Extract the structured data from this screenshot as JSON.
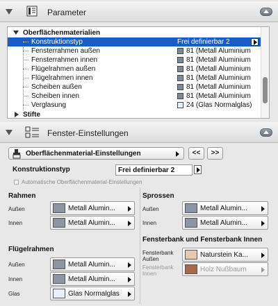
{
  "parameter_panel": {
    "title": "Parameter",
    "tree": {
      "group": "Oberflächenmaterialien",
      "items": [
        {
          "label": "Konstruktionstyp",
          "value": "Frei definierbar 2",
          "selected": true
        },
        {
          "label": "Fensterrahmen außen",
          "value": "81 (Metall Aluminium",
          "swatch": "#7f8997"
        },
        {
          "label": "Fensterrahmen innen",
          "value": "81 (Metall Aluminium",
          "swatch": "#7f8997"
        },
        {
          "label": "Flügelrahmen außen",
          "value": "81 (Metall Aluminium",
          "swatch": "#7f8997"
        },
        {
          "label": "Flügelrahmen innen",
          "value": "81 (Metall Aluminium",
          "swatch": "#7f8997"
        },
        {
          "label": "Scheiben außen",
          "value": "81 (Metall Aluminium",
          "swatch": "#7f8997"
        },
        {
          "label": "Scheiben innen",
          "value": "81 (Metall Aluminium",
          "swatch": "#7f8997"
        },
        {
          "label": "Verglasung",
          "value": "24 (Glas Normalglas)",
          "swatch": "#e8f0fb"
        }
      ],
      "next_group": "Stifte"
    }
  },
  "window_settings": {
    "title": "Fenster-Einstellungen",
    "menu_button": "Oberflächenmaterial-Einstellungen",
    "prev_button": "<<",
    "next_button": ">>",
    "construction_label": "Konstruktionstyp",
    "construction_value": "Frei definierbar 2",
    "auto_checkbox": "Automatische Oberflächenmaterial-Einstellungen",
    "rahmen": {
      "title": "Rahmen",
      "rows": [
        {
          "label": "Außen",
          "value": "Metall Alumin...",
          "swatch": "#8b95a3"
        },
        {
          "label": "Innen",
          "value": "Metall Alumin...",
          "swatch": "#8b95a3"
        }
      ]
    },
    "sprossen": {
      "title": "Sprossen",
      "rows": [
        {
          "label": "Außen",
          "value": "Metall Alumin...",
          "swatch": "#8b95a3"
        },
        {
          "label": "Innen",
          "value": "Metall Alumin...",
          "swatch": "#8b95a3"
        }
      ]
    },
    "fluegelrahmen": {
      "title": "Flügelrahmen",
      "rows": [
        {
          "label": "Außen",
          "value": "Metall Alumin...",
          "swatch": "#8b95a3"
        },
        {
          "label": "Innen",
          "value": "Metall Alumin...",
          "swatch": "#8b95a3"
        },
        {
          "label": "Glas",
          "value": "Glas Normalglas",
          "swatch": "#e8f0fb"
        }
      ]
    },
    "fensterbank": {
      "title": "Fensterbank und Fensterbank Innen",
      "rows": [
        {
          "label": "Fensterbank Außen",
          "label_line1": "Fensterbank",
          "label_line2": "Außen",
          "value": "Naturstein Ka...",
          "swatch": "#e5c9b3"
        },
        {
          "label": "Fensterbank Innen",
          "label_line1": "Fensterbank",
          "label_line2": "Innen",
          "value": "Holz Nußbaum",
          "swatch": "#a9684a",
          "disabled": true
        }
      ]
    }
  }
}
